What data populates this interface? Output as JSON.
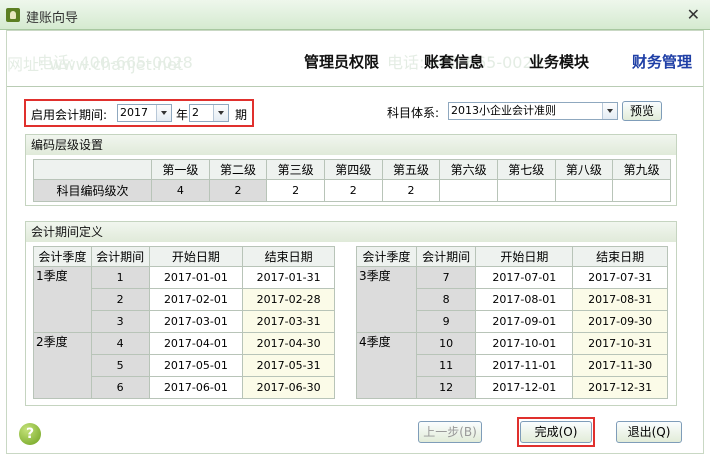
{
  "window": {
    "title": "建账向导"
  },
  "steps": [
    "管理员权限",
    "账套信息",
    "业务模块",
    "财务管理"
  ],
  "period": {
    "label": "启用会计期间:",
    "year": "2017",
    "year_unit": "年",
    "month": "2",
    "month_unit": "期"
  },
  "subject": {
    "label": "科目体系:",
    "value": "2013小企业会计准则",
    "preview": "预览"
  },
  "coding": {
    "title": "编码层级设置",
    "levels": [
      "第一级",
      "第二级",
      "第三级",
      "第四级",
      "第五级",
      "第六级",
      "第七级",
      "第八级",
      "第九级"
    ],
    "row_label": "科目编码级次",
    "values": [
      "4",
      "2",
      "2",
      "2",
      "2",
      "",
      "",
      "",
      ""
    ]
  },
  "periods": {
    "title": "会计期间定义",
    "headers": [
      "会计季度",
      "会计期间",
      "开始日期",
      "结束日期"
    ],
    "left": {
      "quarters": [
        "1季度",
        "2季度"
      ],
      "rows": [
        [
          "1",
          "2017-01-01",
          "2017-01-31"
        ],
        [
          "2",
          "2017-02-01",
          "2017-02-28"
        ],
        [
          "3",
          "2017-03-01",
          "2017-03-31"
        ],
        [
          "4",
          "2017-04-01",
          "2017-04-30"
        ],
        [
          "5",
          "2017-05-01",
          "2017-05-31"
        ],
        [
          "6",
          "2017-06-01",
          "2017-06-30"
        ]
      ]
    },
    "right": {
      "quarters": [
        "3季度",
        "4季度"
      ],
      "rows": [
        [
          "7",
          "2017-07-01",
          "2017-07-31"
        ],
        [
          "8",
          "2017-08-01",
          "2017-08-31"
        ],
        [
          "9",
          "2017-09-01",
          "2017-09-30"
        ],
        [
          "10",
          "2017-10-01",
          "2017-10-31"
        ],
        [
          "11",
          "2017-11-01",
          "2017-11-30"
        ],
        [
          "12",
          "2017-12-01",
          "2017-12-31"
        ]
      ]
    }
  },
  "buttons": {
    "prev": "上一步(B)",
    "finish": "完成(O)",
    "exit": "退出(Q)",
    "help": "?"
  },
  "watermark": {
    "phone": "电话: 400-665-0028",
    "site": "网址: www.chanjet.net"
  }
}
